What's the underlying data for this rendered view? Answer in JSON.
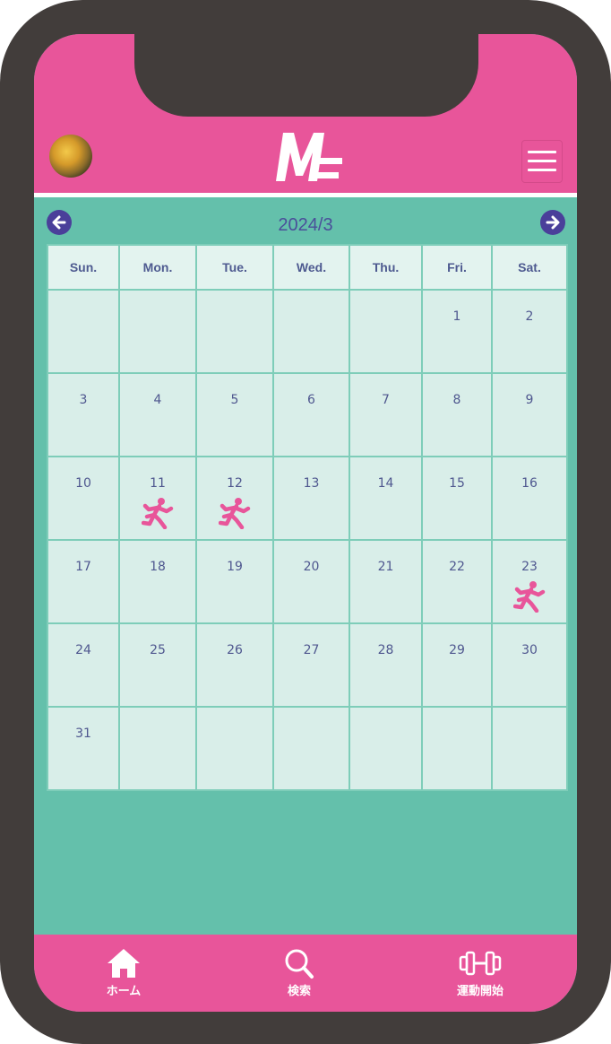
{
  "header": {
    "logo_text": "M",
    "menu_icon": "hamburger-icon",
    "avatar_icon": "profile-avatar"
  },
  "calendar": {
    "month_label": "2024/3",
    "prev_icon": "arrow-left-icon",
    "next_icon": "arrow-right-icon",
    "weekdays": [
      "Sun.",
      "Mon.",
      "Tue.",
      "Wed.",
      "Thu.",
      "Fri.",
      "Sat."
    ],
    "weeks": [
      [
        "",
        "",
        "",
        "",
        "",
        "1",
        "2"
      ],
      [
        "3",
        "4",
        "5",
        "6",
        "7",
        "8",
        "9"
      ],
      [
        "10",
        "11",
        "12",
        "13",
        "14",
        "15",
        "16"
      ],
      [
        "17",
        "18",
        "19",
        "20",
        "21",
        "22",
        "23"
      ],
      [
        "24",
        "25",
        "26",
        "27",
        "28",
        "29",
        "30"
      ],
      [
        "31",
        "",
        "",
        "",
        "",
        "",
        ""
      ]
    ],
    "exercise_days": [
      11,
      12,
      23
    ],
    "exercise_icon": "running-person-icon"
  },
  "footer": {
    "home_label": "ホーム",
    "search_label": "検索",
    "start_label": "運動開始"
  },
  "colors": {
    "brand_pink": "#e8559a",
    "calendar_green": "#64c0ab",
    "frame_dark": "#423d3b",
    "accent_purple": "#4a3f9a"
  }
}
